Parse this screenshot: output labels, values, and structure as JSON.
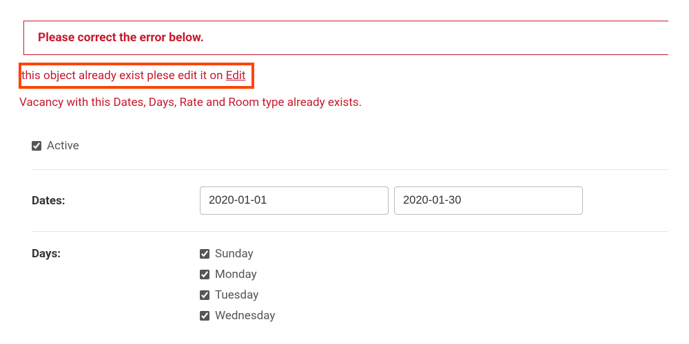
{
  "error_banner": {
    "message": "Please correct the error below."
  },
  "inline_error": {
    "prefix": "this object already exist plese edit it on ",
    "link_text": "Edit"
  },
  "validation_error": "Vacancy with this Dates, Days, Rate and Room type already exists.",
  "form": {
    "active": {
      "label": "Active",
      "checked": true
    },
    "dates": {
      "label": "Dates:",
      "start": "2020-01-01",
      "end": "2020-01-30"
    },
    "days": {
      "label": "Days:",
      "items": [
        {
          "label": "Sunday",
          "checked": true
        },
        {
          "label": "Monday",
          "checked": true
        },
        {
          "label": "Tuesday",
          "checked": true
        },
        {
          "label": "Wednesday",
          "checked": true
        }
      ]
    }
  }
}
